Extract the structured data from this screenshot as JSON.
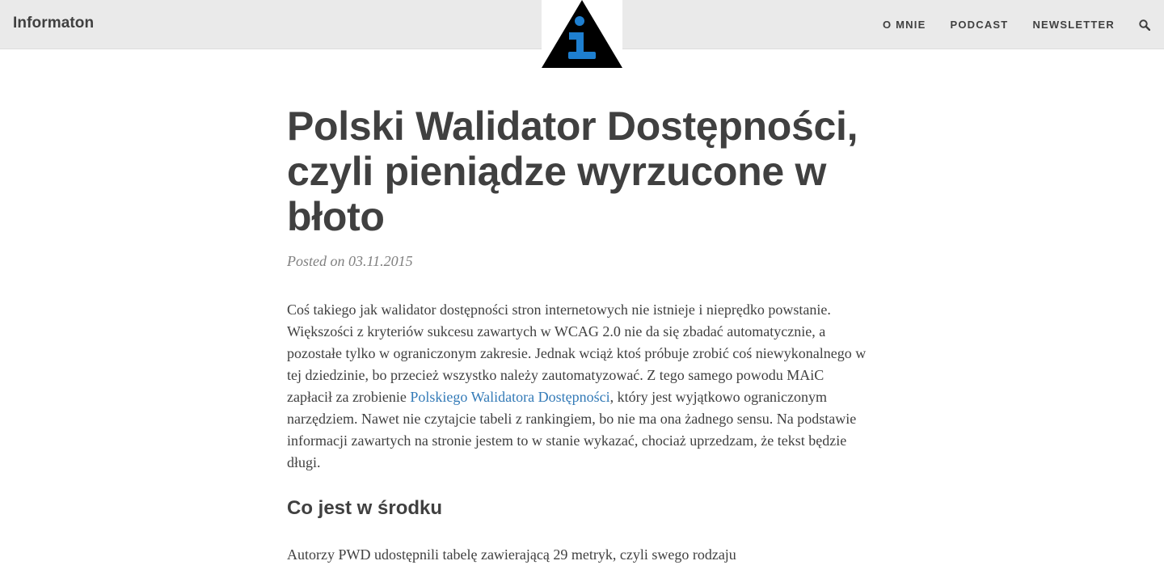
{
  "navbar": {
    "brand": "Informaton",
    "logo_name": "info-triangle-logo",
    "logo_colors": {
      "triangle": "#000000",
      "letter": "#1e7fd0"
    },
    "links": [
      {
        "label": "O MNIE"
      },
      {
        "label": "PODCAST"
      },
      {
        "label": "NEWSLETTER"
      }
    ],
    "search_icon": "search-icon"
  },
  "post": {
    "title": "Polski Walidator Dostępności, czyli pieniądze wyrzucone w błoto",
    "meta": "Posted on 03.11.2015",
    "paragraph1": {
      "before_link": "Coś takiego jak walidator dostępności stron internetowych nie istnieje i nieprędko powstanie. Większości z kryteriów sukcesu zawartych w WCAG 2.0 nie da się zbadać automatycznie, a pozostałe tylko w ograniczonym zakresie. Jednak wciąż ktoś próbuje zrobić coś niewykonalnego w tej dziedzinie, bo przecież wszystko należy zautomatyzować. Z tego samego powodu MAiC zapłacił za zrobienie ",
      "link_text": "Polskiego Walidatora Dostępności",
      "after_link": ", który jest wyjątkowo ograniczonym narzędziem. Nawet nie czytajcie tabeli z rankingiem, bo nie ma ona żadnego sensu. Na podstawie informacji zawartych na stronie jestem to w stanie wykazać, chociaż uprzedzam, że tekst będzie długi."
    },
    "section_heading": "Co jest w środku",
    "paragraph2": "Autorzy PWD udostępnili tabelę zawierającą 29 metryk, czyli swego rodzaju"
  },
  "colors": {
    "navbar_bg": "#eaeaea",
    "text": "#404040",
    "meta": "#808080",
    "link": "#337ab7"
  }
}
